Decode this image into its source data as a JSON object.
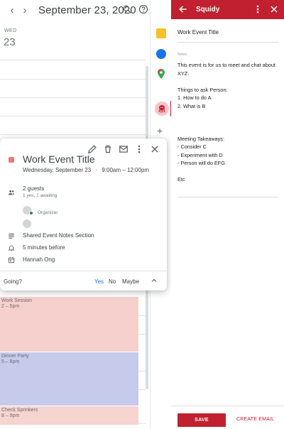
{
  "calendar": {
    "date_title": "September 23, 2020",
    "day_label": "WED",
    "day_number": "23",
    "events": [
      {
        "title": "Work Session",
        "time": "2 – 5pm",
        "color": "#f5d0cc"
      },
      {
        "title": "Dinner Party",
        "time": "5 – 8pm",
        "color": "#c6cbeb"
      },
      {
        "title": "Check Sprinkers",
        "time": "8 – 9pm",
        "color": "#f6d4d0"
      }
    ]
  },
  "toolbar_icons": [
    "chevron-left-icon",
    "chevron-right-icon",
    "search-icon",
    "help-icon",
    "gear-icon"
  ],
  "popup": {
    "title": "Work Event Title",
    "date": "Wednesday, September 23",
    "separator": "·",
    "time": "9:00am – 12:00pm",
    "guests": "2 guests",
    "guests_status": "1 yes, 1 awaiting",
    "organizer_label": "Organizer",
    "description": "Shared Event Notes Section",
    "reminder": "5 minutes before",
    "owner": "Hannah Ong",
    "going_label": "Going?",
    "rsvp": {
      "yes": "Yes",
      "no": "No",
      "maybe": "Maybe"
    },
    "event_color": "#e67c73"
  },
  "panel": {
    "title": "Squidy",
    "event_title": "Work Event Title",
    "notes_label": "Notes",
    "notes_lines": [
      "This event is for us to meet and chat about",
      "XYZ.",
      "",
      "Things to ask Person:",
      "1. How to do A",
      "2. What is B",
      "",
      "",
      "",
      "Meeting Takeaways:",
      "- Consider C",
      "- Experiment with D",
      "- Person will do EFG",
      "",
      "Etc"
    ],
    "save_label": "SAVE",
    "email_label": "CREATE EMAIL",
    "accent_color": "#c0202f"
  }
}
